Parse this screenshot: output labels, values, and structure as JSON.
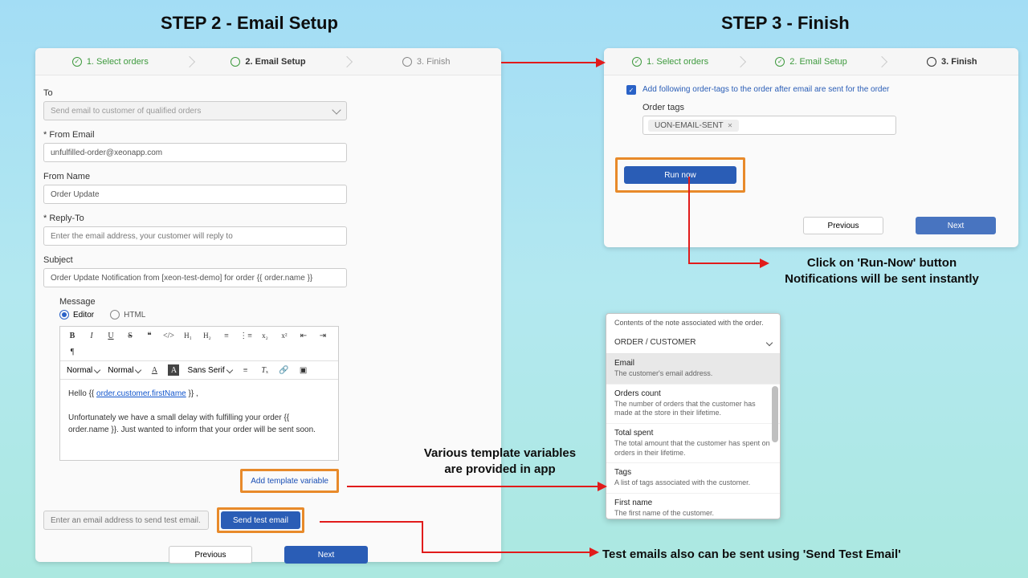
{
  "headings": {
    "step2": "STEP 2 - Email Setup",
    "step3": "STEP 3 - Finish"
  },
  "stepper": {
    "s1": "1. Select orders",
    "s2": "2. Email Setup",
    "s3": "3. Finish"
  },
  "left": {
    "to_label": "To",
    "to_value": "Send email to customer of qualified orders",
    "from_email_label": "* From Email",
    "from_email_value": "unfulfilled-order@xeonapp.com",
    "from_name_label": "From Name",
    "from_name_value": "Order Update",
    "reply_to_label": "* Reply-To",
    "reply_to_placeholder": "Enter the email address, your customer will reply to",
    "subject_label": "Subject",
    "subject_value": "Order Update Notification from [xeon-test-demo] for order {{ order.name }}",
    "message_label": "Message",
    "editor_radio": "Editor",
    "html_radio": "HTML",
    "format_normal": "Normal",
    "font_sans": "Sans Serif",
    "editor_greeting_pre": "Hello {{ ",
    "editor_greeting_var": "order.customer.firstName",
    "editor_greeting_post": " }} ,",
    "editor_body": "Unfortunately we have a small delay with fulfilling your order {{ order.name }}. Just wanted to inform that your order will be sent soon.",
    "add_template_btn": "Add template variable",
    "test_email_placeholder": "Enter an email address to send test email.",
    "send_test_btn": "Send test email",
    "prev_btn": "Previous",
    "next_btn": "Next"
  },
  "right": {
    "checkbox_label": "Add following order-tags to the order after email are sent for the order",
    "order_tags_label": "Order tags",
    "tag_chip": "UON-EMAIL-SENT",
    "run_now": "Run now",
    "prev_btn": "Previous",
    "next_btn": "Next"
  },
  "vars": {
    "note": "Contents of the note associated with the order.",
    "section": "ORDER / CUSTOMER",
    "items": [
      {
        "t": "Email",
        "d": "The customer's email address."
      },
      {
        "t": "Orders count",
        "d": "The number of orders that the customer has made at the store in their lifetime."
      },
      {
        "t": "Total spent",
        "d": "The total amount that the customer has spent on orders in their lifetime."
      },
      {
        "t": "Tags",
        "d": "A list of tags associated with the customer."
      },
      {
        "t": "First name",
        "d": "The first name of the customer."
      }
    ]
  },
  "captions": {
    "run_now": "Click on 'Run-Now' button\nNotifications will be sent instantly",
    "vars": "Various template variables\nare provided in app",
    "test": "Test emails also can be sent using 'Send Test Email'"
  }
}
